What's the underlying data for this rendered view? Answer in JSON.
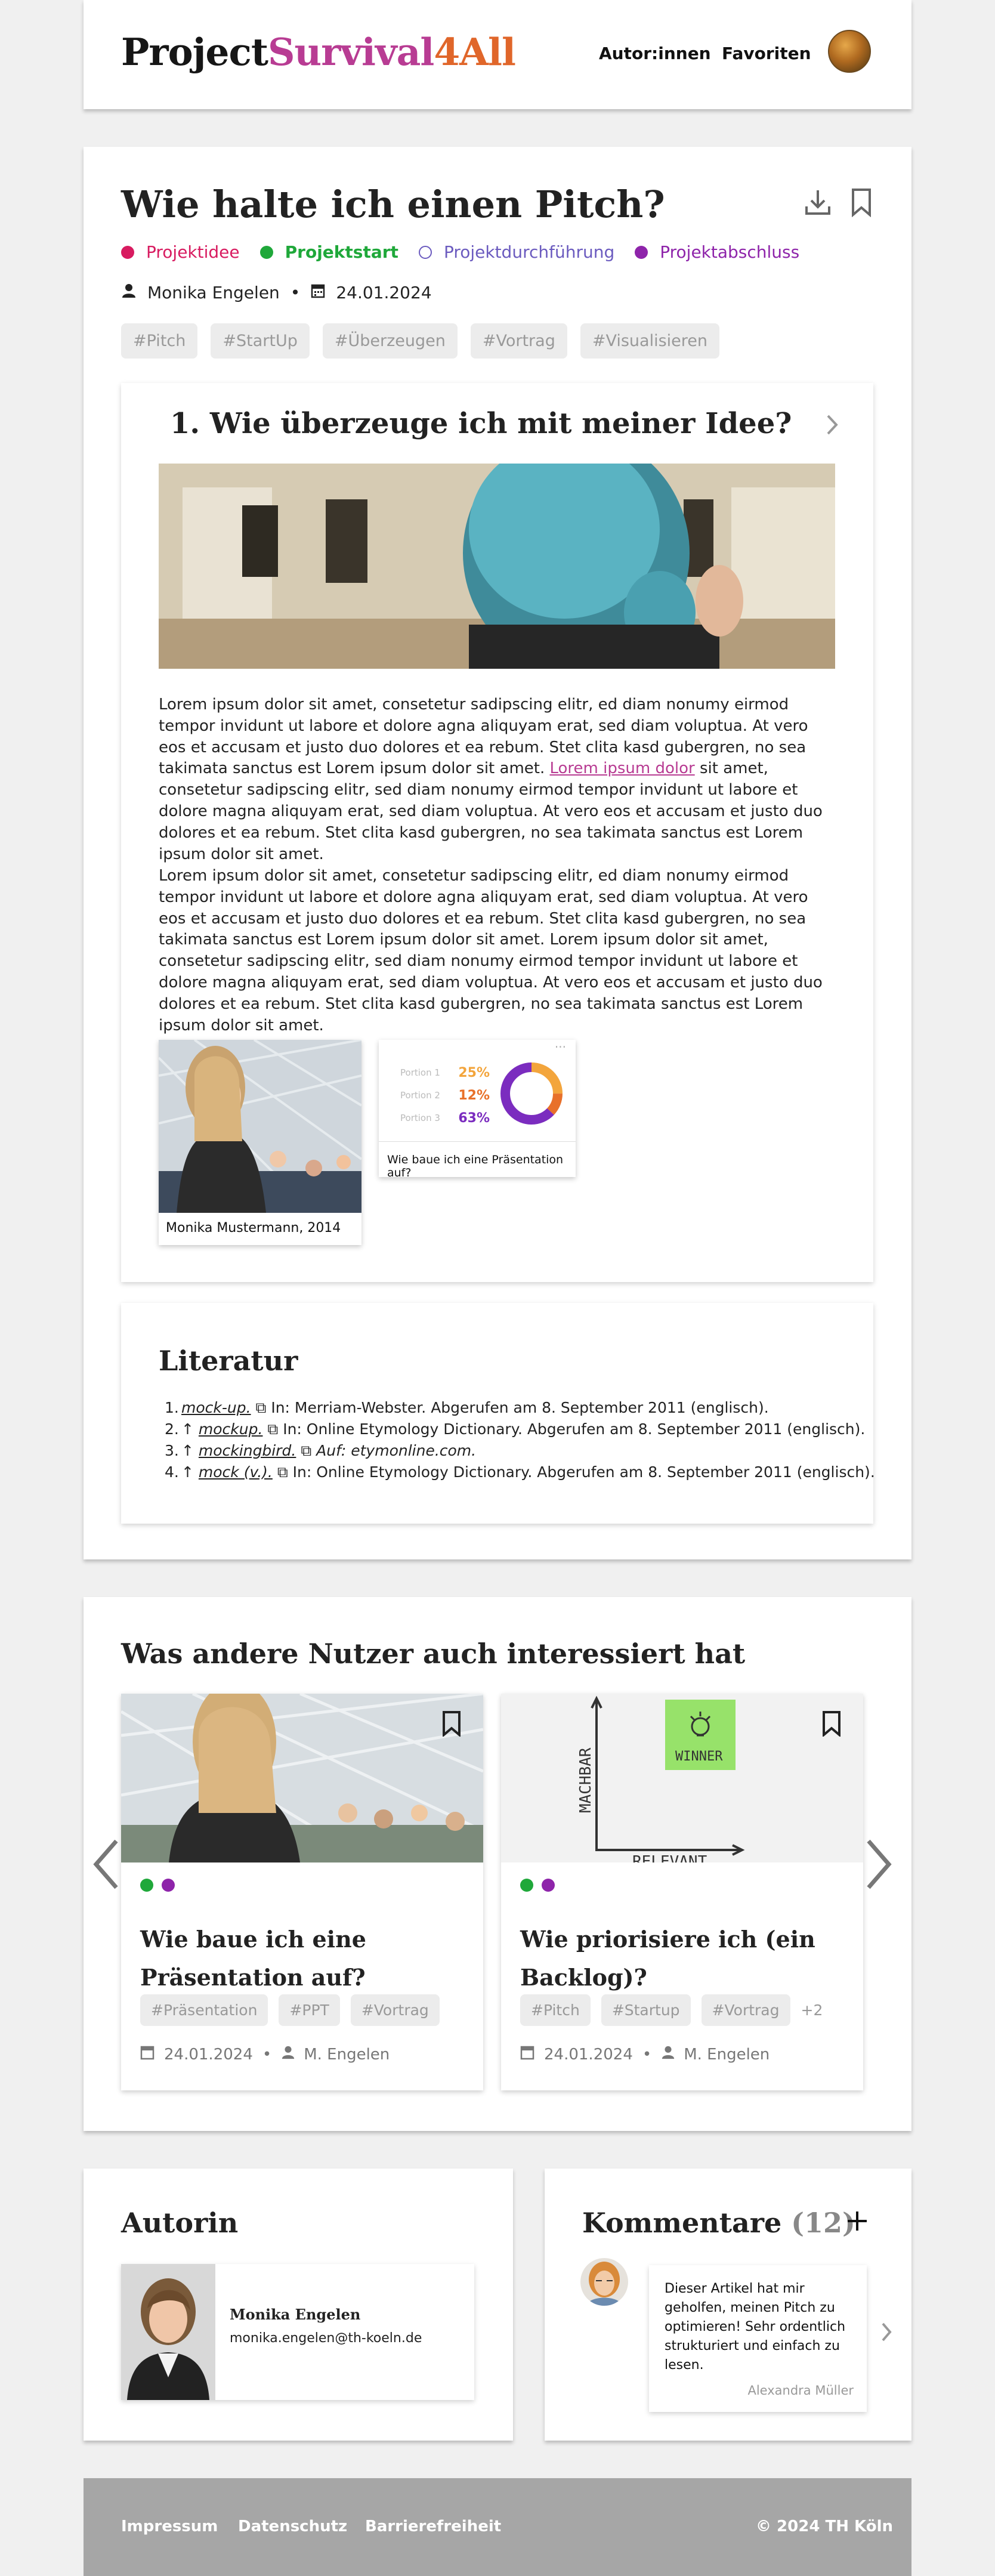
{
  "brand": {
    "part1": "Project",
    "part2": "Survival",
    "part3": "4All"
  },
  "nav": {
    "authors": "Autor:innen",
    "favorites": "Favoriten"
  },
  "article": {
    "title": "Wie halte ich einen Pitch?",
    "phases": [
      {
        "label": "Projektidee",
        "color": "#d81b60",
        "filled": true
      },
      {
        "label": "Projektstart",
        "color": "#1fa83a",
        "filled": true
      },
      {
        "label": "Projektdurchführung",
        "color": "#6b5bbf",
        "filled": false
      },
      {
        "label": "Projektabschluss",
        "color": "#8e24aa",
        "filled": true
      }
    ],
    "author": "Monika Engelen",
    "date": "24.01.2024",
    "tags": [
      "#Pitch",
      "#StartUp",
      "#Überzeugen",
      "#Vortrag",
      "#Visualisieren"
    ]
  },
  "chapter": {
    "number": "1.",
    "title": "Wie überzeuge ich mit meiner Idee?",
    "p1_before": "Lorem ipsum dolor sit amet, consetetur sadipscing elitr, ed diam nonumy eirmod tempor invidunt ut labore et dolore agna aliquyam erat, sed diam voluptua. At vero eos et accusam et justo duo dolores et ea rebum. Stet clita kasd gubergren, no sea takimata sanctus est Lorem ipsum dolor sit amet. ",
    "p1_link": "Lorem ipsum dolor",
    "p1_after": " sit amet, consetetur sadipscing elitr, sed diam nonumy eirmod tempor invidunt ut labore et dolore magna aliquyam erat, sed diam voluptua. At vero eos et accusam et justo duo dolores et ea rebum. Stet clita kasd gubergren, no sea takimata sanctus est Lorem ipsum dolor sit amet.",
    "p2": "Lorem ipsum dolor sit amet, consetetur sadipscing elitr, ed diam nonumy eirmod tempor invidunt ut labore et dolore agna aliquyam erat, sed diam voluptua. At vero eos et accusam et justo duo dolores et ea rebum. Stet clita kasd gubergren, no sea takimata sanctus est Lorem ipsum dolor sit amet. Lorem ipsum dolor sit amet, consetetur sadipscing elitr, sed diam nonumy eirmod tempor invidunt ut labore et dolore magna aliquyam erat, sed diam voluptua. At vero eos et accusam et justo duo dolores et ea rebum. Stet clita kasd gubergren, no sea takimata sanctus est Lorem ipsum dolor sit amet.",
    "media": [
      {
        "caption": "Monika Mustermann, 2014"
      },
      {
        "caption": "Wie baue ich eine Präsentation auf?",
        "donut": [
          {
            "label": "Portion 1",
            "value": "25%",
            "color": "#f3a53c"
          },
          {
            "label": "Portion 2",
            "value": "12%",
            "color": "#e8702a"
          },
          {
            "label": "Portion 3",
            "value": "63%",
            "color": "#7b2cbf"
          }
        ]
      }
    ]
  },
  "literatur": {
    "title": "Literatur",
    "items": [
      {
        "num": "1.",
        "marker": "",
        "ref": "mock-up.",
        "rest": " In: Merriam-Webster. Abgerufen am 8. September 2011 (englisch)."
      },
      {
        "num": "2.",
        "marker": "↑ ",
        "ref": "mockup.",
        "rest": " In: Online Etymology Dictionary. Abgerufen am 8. September 2011 (englisch)."
      },
      {
        "num": "3.",
        "marker": "↑ ",
        "ref": "mockingbird.",
        "rest": " Auf: etymonline.com."
      },
      {
        "num": "4.",
        "marker": "↑ ",
        "ref": "mock (v.).",
        "rest": " In: Online Etymology Dictionary. Abgerufen am 8. September 2011 (englisch)."
      }
    ]
  },
  "related": {
    "title": "Was andere Nutzer auch interessiert hat",
    "cards": [
      {
        "title": "Wie baue ich eine Präsentation auf?",
        "tags": [
          "#Präsentation",
          "#PPT",
          "#Vortrag"
        ],
        "more": "",
        "date": "24.01.2024",
        "author": "M. Engelen",
        "dots": [
          "#1fa83a",
          "#8e24aa"
        ]
      },
      {
        "title": "Wie priorisiere ich (ein Backlog)?",
        "tags": [
          "#Pitch",
          "#Startup",
          "#Vortrag"
        ],
        "more": "+2",
        "date": "24.01.2024",
        "author": "M. Engelen",
        "dots": [
          "#1fa83a",
          "#8e24aa"
        ],
        "sketch": {
          "y": "MACHBAR",
          "x": "RELEVANT",
          "note": "WINNER"
        }
      }
    ]
  },
  "autorin": {
    "title": "Autorin",
    "name": "Monika Engelen",
    "email": "monika.engelen@th-koeln.de"
  },
  "kommentare": {
    "title": "Kommentare",
    "count": "(12)",
    "comment": "Dieser Artikel hat mir geholfen, meinen Pitch zu optimieren! Sehr ordentlich strukturiert und einfach zu lesen.",
    "commenter": "Alexandra Müller"
  },
  "footer": {
    "impressum": "Impressum",
    "datenschutz": "Datenschutz",
    "barrierefreiheit": "Barrierefreiheit",
    "copyright": "© 2024 TH Köln"
  }
}
